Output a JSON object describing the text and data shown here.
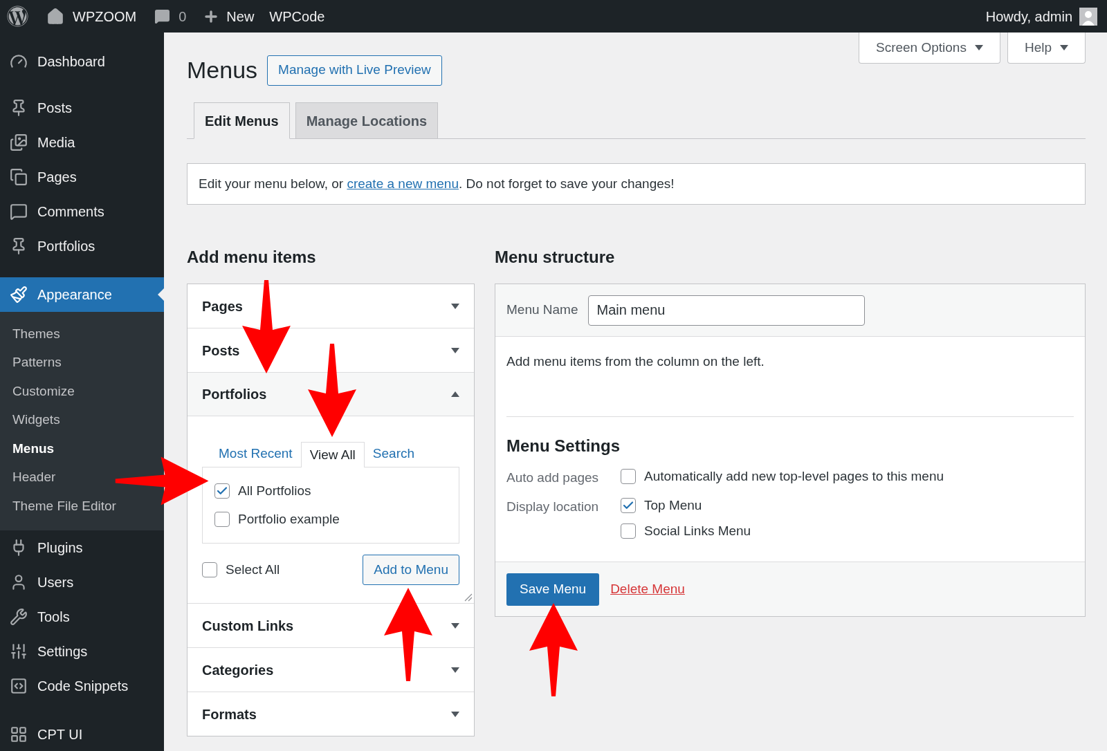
{
  "admin_bar": {
    "items": [
      {
        "kind": "logo"
      },
      {
        "kind": "site",
        "label": "WPZOOM"
      },
      {
        "kind": "comments",
        "label": "0"
      },
      {
        "kind": "new",
        "label": "New"
      },
      {
        "kind": "plain",
        "label": "WPCode"
      }
    ],
    "account": "Howdy, admin"
  },
  "sidebar": {
    "items": [
      {
        "label": "Dashboard",
        "selected": false
      },
      {
        "label": "Posts",
        "selected": false
      },
      {
        "label": "Media",
        "selected": false
      },
      {
        "label": "Pages",
        "selected": false
      },
      {
        "label": "Comments",
        "selected": false
      },
      {
        "label": "Portfolios",
        "selected": false
      },
      {
        "label": "Appearance",
        "selected": true,
        "children": [
          {
            "label": "Themes",
            "selected": false
          },
          {
            "label": "Patterns",
            "selected": false
          },
          {
            "label": "Customize",
            "selected": false
          },
          {
            "label": "Widgets",
            "selected": false
          },
          {
            "label": "Menus",
            "selected": true
          },
          {
            "label": "Header",
            "selected": false
          },
          {
            "label": "Theme File Editor",
            "selected": false
          }
        ]
      },
      {
        "label": "Plugins",
        "selected": false
      },
      {
        "label": "Users",
        "selected": false
      },
      {
        "label": "Tools",
        "selected": false
      },
      {
        "label": "Settings",
        "selected": false
      },
      {
        "label": "Code Snippets",
        "selected": false
      },
      {
        "label": "CPT UI",
        "selected": false
      }
    ]
  },
  "screen_meta": [
    "Screen Options",
    "Help"
  ],
  "title": "Menus",
  "live_preview_button": "Manage with Live Preview",
  "tabs": [
    {
      "label": "Edit Menus",
      "selected": true
    },
    {
      "label": "Manage Locations",
      "selected": false
    }
  ],
  "notice": {
    "before": "Edit your menu below, or ",
    "link": "create a new menu",
    "after": ". Do not forget to save your changes!"
  },
  "add_menu_items": {
    "heading": "Add menu items",
    "sections": [
      {
        "title": "Pages",
        "expanded": false
      },
      {
        "title": "Posts",
        "expanded": false
      },
      {
        "title": "Portfolios",
        "expanded": true
      },
      {
        "title": "Custom Links",
        "expanded": false
      },
      {
        "title": "Categories",
        "expanded": false
      },
      {
        "title": "Formats",
        "expanded": false
      }
    ],
    "panel": {
      "tabs": [
        {
          "label": "Most Recent",
          "selected": false
        },
        {
          "label": "View All",
          "selected": true
        },
        {
          "label": "Search",
          "selected": false
        }
      ],
      "items": [
        {
          "label": "All Portfolios",
          "checked": true
        },
        {
          "label": "Portfolio example",
          "checked": false
        }
      ],
      "select_all": {
        "label": "Select All",
        "checked": false
      },
      "add_button": "Add to Menu"
    }
  },
  "menu_structure": {
    "heading": "Menu structure",
    "name_label": "Menu Name",
    "name_value": "Main menu",
    "instructions": "Add menu items from the column on the left.",
    "settings_heading": "Menu Settings",
    "settings": [
      {
        "label": "Auto add pages",
        "options": [
          {
            "label": "Automatically add new top-level pages to this menu",
            "checked": false
          }
        ]
      },
      {
        "label": "Display location",
        "options": [
          {
            "label": "Top Menu",
            "checked": true
          },
          {
            "label": "Social Links Menu",
            "checked": false
          }
        ]
      }
    ],
    "save_button": "Save Menu",
    "delete_link": "Delete Menu"
  }
}
